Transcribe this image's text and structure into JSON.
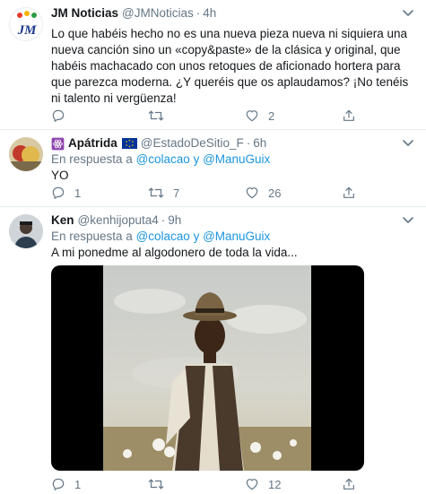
{
  "tweets": [
    {
      "name": "JM Noticias",
      "handle": "@JMNoticias",
      "separator": "·",
      "time": "4h",
      "avatar_logo": "JM",
      "text": "Lo que habéis hecho no es una nueva pieza nueva ni siquiera una nueva canción sino un «copy&paste» de la clásica y original, que habéis machacado con unos retoques de aficionado hortera para que parezca moderna. ¿Y queréis que os aplaudamos? ¡No tenéis ni talento ni vergüenza!",
      "replies": "",
      "retweets": "",
      "likes": "2"
    },
    {
      "name": "Apátrida",
      "handle": "@EstadoDeSitio_F",
      "separator": "·",
      "time": "6h",
      "reply_prefix": "En respuesta a",
      "reply_users": "@colacao y @ManuGuix",
      "text": "YO",
      "replies": "1",
      "retweets": "7",
      "likes": "26"
    },
    {
      "name": "Ken",
      "handle": "@kenhijoputa4",
      "separator": "·",
      "time": "9h",
      "reply_prefix": "En respuesta a",
      "reply_users": "@colacao y @ManuGuix",
      "text": "A mi ponedme al algodonero de toda la vida...",
      "replies": "1",
      "retweets": "",
      "likes": "12"
    }
  ],
  "icons": {
    "reply": "reply-icon",
    "retweet": "retweet-icon",
    "like": "heart-icon",
    "share": "share-icon",
    "more": "chevron-down-icon",
    "badge": "atom-icon",
    "flag": "eu-flag-icon"
  },
  "colors": {
    "link": "#1b95e0",
    "secondary_text": "#657786",
    "divider": "#e6ecf0",
    "badge_purple": "#8e44ad",
    "eu_blue": "#003399"
  }
}
